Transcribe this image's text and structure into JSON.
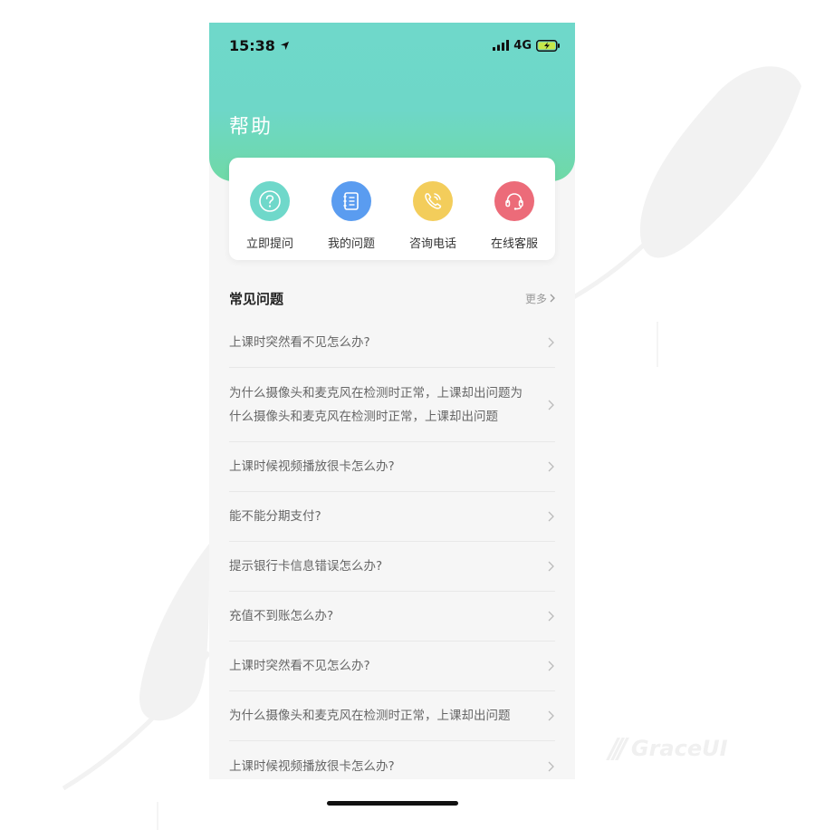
{
  "brand": {
    "slashes": "///",
    "name": "GraceUI"
  },
  "status_bar": {
    "time": "15:38",
    "network": "4G"
  },
  "page": {
    "title": "帮助"
  },
  "quick_actions": [
    {
      "label": "立即提问",
      "icon": "question-icon",
      "color": "#6fd8ca"
    },
    {
      "label": "我的问题",
      "icon": "notebook-icon",
      "color": "#5a9cf0"
    },
    {
      "label": "咨询电话",
      "icon": "phone-icon",
      "color": "#f3cd5b"
    },
    {
      "label": "在线客服",
      "icon": "headset-icon",
      "color": "#ec6b79"
    }
  ],
  "faq": {
    "title": "常见问题",
    "more_label": "更多",
    "items": [
      {
        "text": "上课时突然看不见怎么办?"
      },
      {
        "text": "为什么摄像头和麦克风在检测时正常，上课却出问题为什么摄像头和麦克风在检测时正常，上课却出问题"
      },
      {
        "text": "上课时候视频播放很卡怎么办?"
      },
      {
        "text": "能不能分期支付?"
      },
      {
        "text": "提示银行卡信息错误怎么办?"
      },
      {
        "text": "充值不到账怎么办?"
      },
      {
        "text": "上课时突然看不见怎么办?"
      },
      {
        "text": "为什么摄像头和麦克风在检测时正常，上课却出问题"
      },
      {
        "text": "上课时候视频播放很卡怎么办?"
      }
    ]
  }
}
